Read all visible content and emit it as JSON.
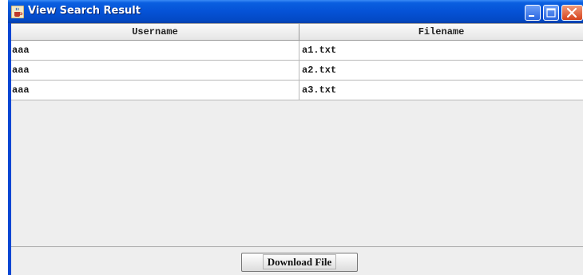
{
  "window": {
    "title": "View Search Result",
    "app_icon": "java-coffee-cup-icon",
    "controls": [
      "minimize-icon",
      "maximize-icon",
      "close-icon"
    ]
  },
  "table": {
    "columns": [
      "Username",
      "Filename"
    ],
    "rows": [
      [
        "aaa",
        "a1.txt"
      ],
      [
        "aaa",
        "a2.txt"
      ],
      [
        "aaa",
        "a3.txt"
      ]
    ]
  },
  "footer": {
    "download_label": "Download File"
  },
  "colors": {
    "titlebar": "#0552d6",
    "frame": "#0846d3",
    "close_button": "#d6431c",
    "panel_background": "#eeeeee"
  }
}
